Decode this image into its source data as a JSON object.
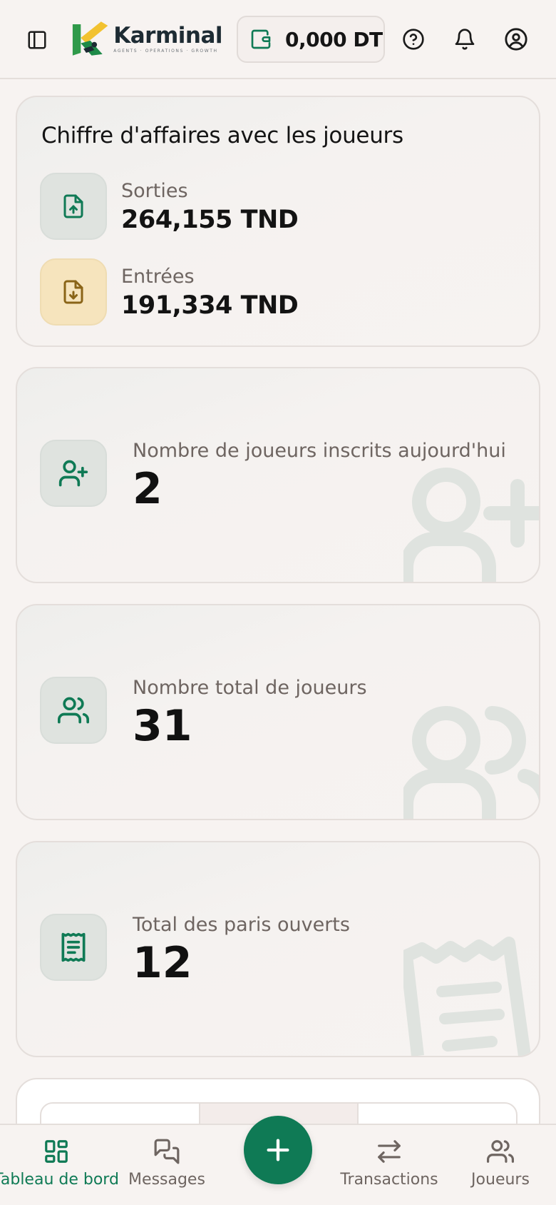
{
  "header": {
    "logo_name": "Karminal",
    "logo_tagline": "AGENTS · OPERATIONS · GROWTH",
    "wallet_balance": "0,000 DT"
  },
  "revenue": {
    "title": "Chiffre d'affaires avec les joueurs",
    "outflows_label": "Sorties",
    "outflows_value": "264,155 TND",
    "inflows_label": "Entrées",
    "inflows_value": "191,334 TND"
  },
  "stats": {
    "registered_today_label": "Nombre de joueurs inscrits aujourd'hui",
    "registered_today_value": "2",
    "total_players_label": "Nombre total de joueurs",
    "total_players_value": "31",
    "open_bets_label": "Total des paris ouverts",
    "open_bets_value": "12"
  },
  "nav": {
    "dashboard": "Tableau de bord",
    "messages": "Messages",
    "transactions": "Transactions",
    "players": "Joueurs"
  },
  "colors": {
    "accent": "#0f7a55",
    "background": "#f7f3f1",
    "inflow_icon": "#8a6417"
  },
  "icons": [
    "sidebar-icon",
    "wallet-icon",
    "help-icon",
    "bell-icon",
    "user-icon",
    "upload-icon",
    "download-icon",
    "user-plus-icon",
    "users-icon",
    "receipt-icon",
    "grid-icon",
    "messages-icon",
    "plus-icon",
    "arrows-icon"
  ]
}
